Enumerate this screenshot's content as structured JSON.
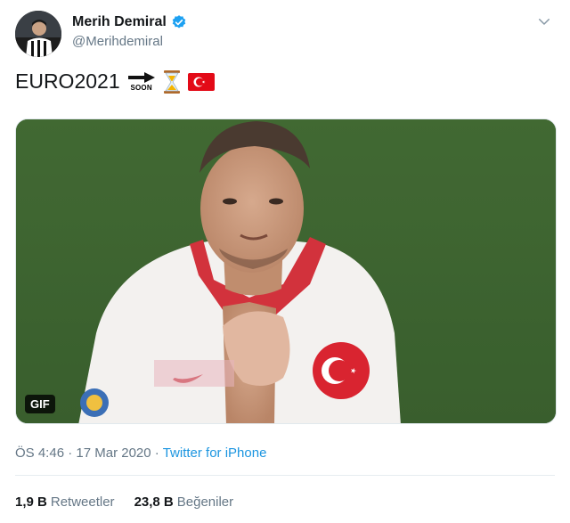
{
  "author": {
    "display_name": "Merih Demiral",
    "handle": "@Merihdemiral",
    "verified": true
  },
  "tweet": {
    "text": "EURO2021",
    "emojis": [
      "soon-arrow",
      "hourglass",
      "turkey-flag"
    ],
    "soon_label": "SOON"
  },
  "media": {
    "badge": "GIF"
  },
  "meta": {
    "time": "ÖS 4:46",
    "separator1": "·",
    "date": "17 Mar 2020",
    "separator2": "·",
    "source": "Twitter for iPhone"
  },
  "stats": {
    "retweets_count": "1,9 B",
    "retweets_label": "Retweetler",
    "likes_count": "23,8 B",
    "likes_label": "Beğeniler"
  },
  "colors": {
    "link": "#1b95e0",
    "secondary_text": "#657786",
    "verified_blue": "#1da1f2"
  }
}
